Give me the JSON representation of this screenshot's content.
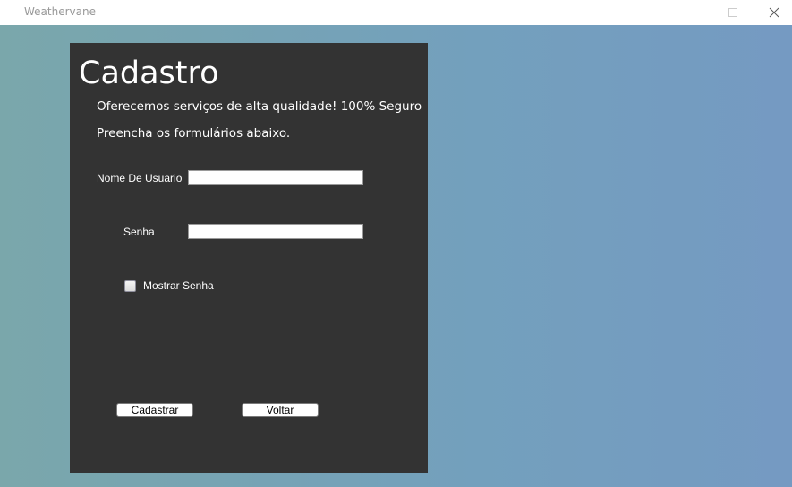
{
  "window": {
    "title": "Weathervane"
  },
  "form": {
    "heading": "Cadastro",
    "tagline": "Oferecemos serviços de alta qualidade! 100% Seguro",
    "instructions": "Preencha os formulários abaixo.",
    "username_label": "Nome De Usuario",
    "username_value": "",
    "password_label": "Senha",
    "password_value": "",
    "show_password_label": "Mostrar Senha",
    "show_password_checked": false,
    "submit_label": "Cadastrar",
    "back_label": "Voltar"
  },
  "colors": {
    "panel": "#333333",
    "background_left": "#7aa7ab",
    "background_right": "#759ac2",
    "text": "#ffffff"
  },
  "icons": {
    "minimize": "minimize-icon",
    "maximize": "maximize-icon",
    "close": "close-icon"
  }
}
